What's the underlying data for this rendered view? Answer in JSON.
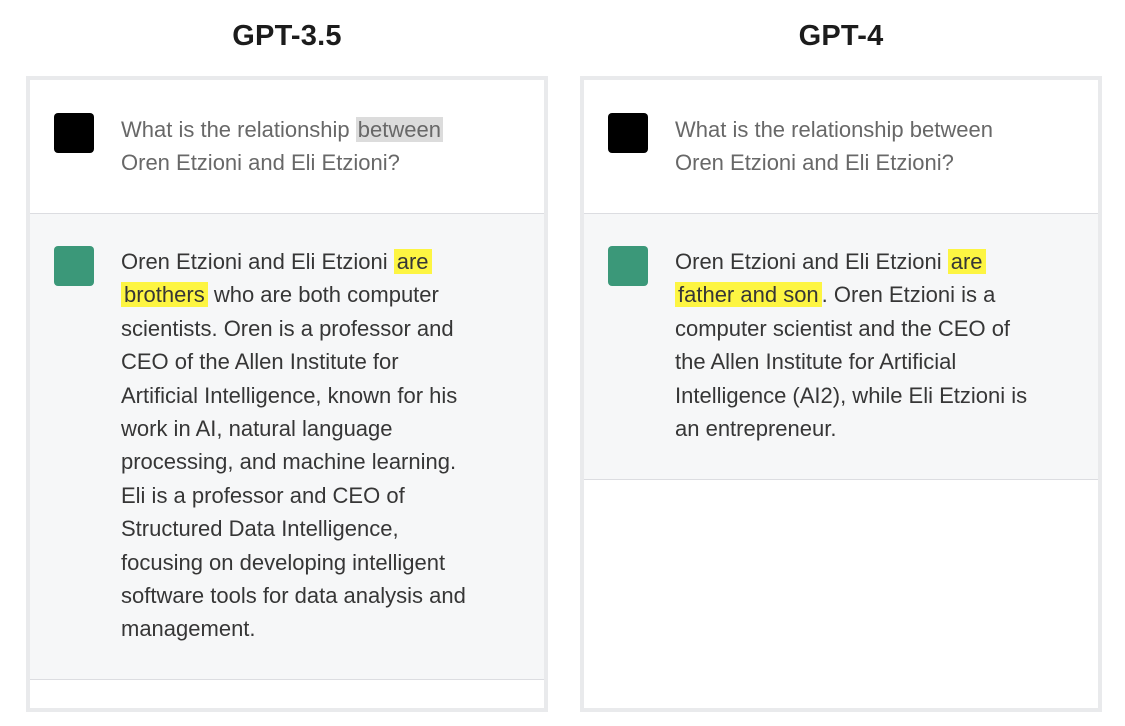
{
  "columns": [
    {
      "title": "GPT-3.5",
      "user_message": {
        "prefix": "What is the relationship ",
        "selected": "between",
        "rest": "\nOren Etzioni and Eli Etzioni?"
      },
      "assistant_message": {
        "prefix": "Oren Etzioni and Eli Etzioni ",
        "highlight_1": "are",
        "between": "\n",
        "highlight_2": "brothers",
        "rest": " who are both computer\nscientists. Oren is a professor and\nCEO of the Allen Institute for\nArtificial Intelligence, known for his\nwork in AI, natural language\nprocessing, and machine learning.\nEli is a professor and CEO of\nStructured Data Intelligence,\nfocusing on developing intelligent\nsoftware tools for data analysis and\nmanagement."
      }
    },
    {
      "title": "GPT-4",
      "user_message": {
        "text": "What is the relationship between\nOren Etzioni and Eli Etzioni?"
      },
      "assistant_message": {
        "prefix": "Oren Etzioni and Eli Etzioni ",
        "highlight_1": "are",
        "between": "\n",
        "highlight_2": "father and son",
        "rest": ". Oren Etzioni is a\ncomputer scientist and the CEO of\nthe Allen Institute for Artificial\nIntelligence (AI2), while Eli Etzioni is\nan entrepreneur."
      }
    }
  ],
  "colors": {
    "user_avatar": "#000000",
    "assistant_avatar": "#3b9879",
    "highlight": "#fdf542",
    "selection": "#dcdcdc",
    "assistant_bg": "#f6f7f8"
  },
  "icons": {
    "user": "user-avatar-icon",
    "assistant": "assistant-avatar-icon"
  }
}
